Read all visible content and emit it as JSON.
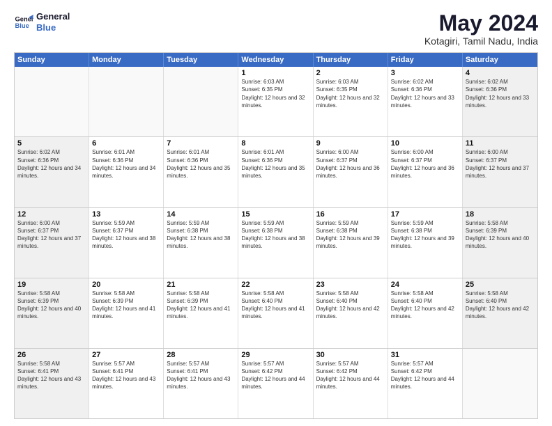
{
  "logo": {
    "line1": "General",
    "line2": "Blue"
  },
  "title": "May 2024",
  "location": "Kotagiri, Tamil Nadu, India",
  "days_of_week": [
    "Sunday",
    "Monday",
    "Tuesday",
    "Wednesday",
    "Thursday",
    "Friday",
    "Saturday"
  ],
  "weeks": [
    [
      {
        "day": "",
        "info": ""
      },
      {
        "day": "",
        "info": ""
      },
      {
        "day": "",
        "info": ""
      },
      {
        "day": "1",
        "info": "Sunrise: 6:03 AM\nSunset: 6:35 PM\nDaylight: 12 hours and 32 minutes."
      },
      {
        "day": "2",
        "info": "Sunrise: 6:03 AM\nSunset: 6:35 PM\nDaylight: 12 hours and 32 minutes."
      },
      {
        "day": "3",
        "info": "Sunrise: 6:02 AM\nSunset: 6:36 PM\nDaylight: 12 hours and 33 minutes."
      },
      {
        "day": "4",
        "info": "Sunrise: 6:02 AM\nSunset: 6:36 PM\nDaylight: 12 hours and 33 minutes."
      }
    ],
    [
      {
        "day": "5",
        "info": "Sunrise: 6:02 AM\nSunset: 6:36 PM\nDaylight: 12 hours and 34 minutes."
      },
      {
        "day": "6",
        "info": "Sunrise: 6:01 AM\nSunset: 6:36 PM\nDaylight: 12 hours and 34 minutes."
      },
      {
        "day": "7",
        "info": "Sunrise: 6:01 AM\nSunset: 6:36 PM\nDaylight: 12 hours and 35 minutes."
      },
      {
        "day": "8",
        "info": "Sunrise: 6:01 AM\nSunset: 6:36 PM\nDaylight: 12 hours and 35 minutes."
      },
      {
        "day": "9",
        "info": "Sunrise: 6:00 AM\nSunset: 6:37 PM\nDaylight: 12 hours and 36 minutes."
      },
      {
        "day": "10",
        "info": "Sunrise: 6:00 AM\nSunset: 6:37 PM\nDaylight: 12 hours and 36 minutes."
      },
      {
        "day": "11",
        "info": "Sunrise: 6:00 AM\nSunset: 6:37 PM\nDaylight: 12 hours and 37 minutes."
      }
    ],
    [
      {
        "day": "12",
        "info": "Sunrise: 6:00 AM\nSunset: 6:37 PM\nDaylight: 12 hours and 37 minutes."
      },
      {
        "day": "13",
        "info": "Sunrise: 5:59 AM\nSunset: 6:37 PM\nDaylight: 12 hours and 38 minutes."
      },
      {
        "day": "14",
        "info": "Sunrise: 5:59 AM\nSunset: 6:38 PM\nDaylight: 12 hours and 38 minutes."
      },
      {
        "day": "15",
        "info": "Sunrise: 5:59 AM\nSunset: 6:38 PM\nDaylight: 12 hours and 38 minutes."
      },
      {
        "day": "16",
        "info": "Sunrise: 5:59 AM\nSunset: 6:38 PM\nDaylight: 12 hours and 39 minutes."
      },
      {
        "day": "17",
        "info": "Sunrise: 5:59 AM\nSunset: 6:38 PM\nDaylight: 12 hours and 39 minutes."
      },
      {
        "day": "18",
        "info": "Sunrise: 5:58 AM\nSunset: 6:39 PM\nDaylight: 12 hours and 40 minutes."
      }
    ],
    [
      {
        "day": "19",
        "info": "Sunrise: 5:58 AM\nSunset: 6:39 PM\nDaylight: 12 hours and 40 minutes."
      },
      {
        "day": "20",
        "info": "Sunrise: 5:58 AM\nSunset: 6:39 PM\nDaylight: 12 hours and 41 minutes."
      },
      {
        "day": "21",
        "info": "Sunrise: 5:58 AM\nSunset: 6:39 PM\nDaylight: 12 hours and 41 minutes."
      },
      {
        "day": "22",
        "info": "Sunrise: 5:58 AM\nSunset: 6:40 PM\nDaylight: 12 hours and 41 minutes."
      },
      {
        "day": "23",
        "info": "Sunrise: 5:58 AM\nSunset: 6:40 PM\nDaylight: 12 hours and 42 minutes."
      },
      {
        "day": "24",
        "info": "Sunrise: 5:58 AM\nSunset: 6:40 PM\nDaylight: 12 hours and 42 minutes."
      },
      {
        "day": "25",
        "info": "Sunrise: 5:58 AM\nSunset: 6:40 PM\nDaylight: 12 hours and 42 minutes."
      }
    ],
    [
      {
        "day": "26",
        "info": "Sunrise: 5:58 AM\nSunset: 6:41 PM\nDaylight: 12 hours and 43 minutes."
      },
      {
        "day": "27",
        "info": "Sunrise: 5:57 AM\nSunset: 6:41 PM\nDaylight: 12 hours and 43 minutes."
      },
      {
        "day": "28",
        "info": "Sunrise: 5:57 AM\nSunset: 6:41 PM\nDaylight: 12 hours and 43 minutes."
      },
      {
        "day": "29",
        "info": "Sunrise: 5:57 AM\nSunset: 6:42 PM\nDaylight: 12 hours and 44 minutes."
      },
      {
        "day": "30",
        "info": "Sunrise: 5:57 AM\nSunset: 6:42 PM\nDaylight: 12 hours and 44 minutes."
      },
      {
        "day": "31",
        "info": "Sunrise: 5:57 AM\nSunset: 6:42 PM\nDaylight: 12 hours and 44 minutes."
      },
      {
        "day": "",
        "info": ""
      }
    ]
  ]
}
